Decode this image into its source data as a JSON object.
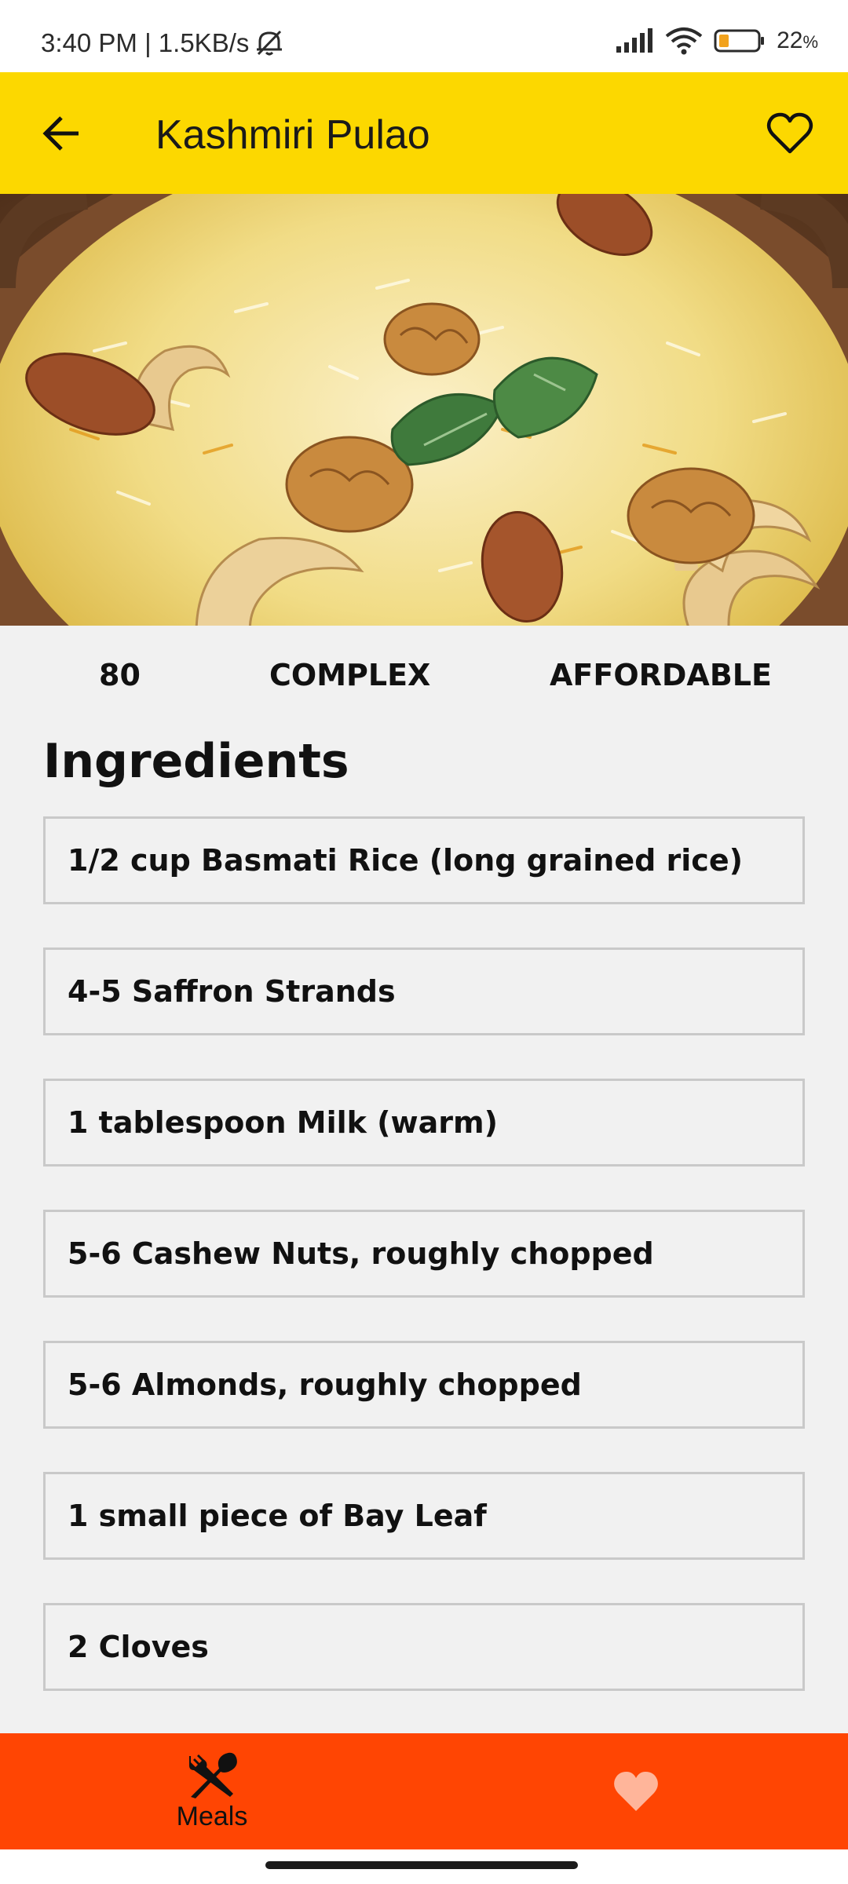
{
  "status_bar": {
    "time_speed": "3:40 PM | 1.5KB/s",
    "battery_percent": "22",
    "battery_suffix": "%",
    "icons": [
      "mute-bell-icon",
      "signal-icon",
      "wifi-icon",
      "battery-icon"
    ]
  },
  "app_bar": {
    "title": "Kashmiri Pulao",
    "back_icon": "arrow-left-icon",
    "favorite_icon": "heart-outline-icon"
  },
  "meal": {
    "duration": "80",
    "complexity": "COMPLEX",
    "affordability": "AFFORDABLE"
  },
  "ingredients_title": "Ingredients",
  "ingredients": [
    "1/2 cup Basmati Rice (long grained rice)",
    "4-5 Saffron Strands",
    "1 tablespoon Milk (warm)",
    "5-6 Cashew Nuts, roughly chopped",
    "5-6 Almonds, roughly chopped",
    "1 small piece of Bay Leaf",
    "2 Cloves"
  ],
  "bottom_nav": {
    "meals_label": "Meals",
    "meals_icon": "fork-knife-icon",
    "favorites_icon": "heart-icon"
  },
  "colors": {
    "app_bar": "#fcd800",
    "bottom_nav": "#ff4503",
    "background": "#f1f1f1",
    "favorite_heart": "#ffb59a"
  }
}
